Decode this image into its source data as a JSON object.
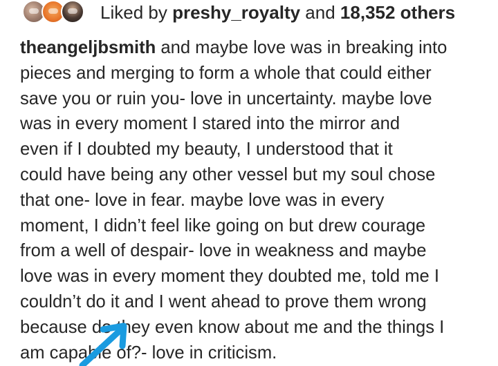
{
  "likes": {
    "prefix": "Liked by",
    "user": "preshy_royalty",
    "conjunction": "and",
    "count": "18,352 others"
  },
  "caption": {
    "username": "theangeljbsmith",
    "lines": [
      " and maybe love was in breaking into",
      "pieces and merging to form a whole that could either",
      "save you or ruin you- love in uncertainty. maybe love",
      "was in every moment I stared into the mirror and",
      "even if I doubted my beauty, I understood that it",
      "could have being any other vessel but my soul chose",
      "that one- love in fear. maybe love was in every",
      "moment, I didn’t feel like going on but drew courage",
      "from a well of despair- love in weakness and maybe",
      "love was in every moment they doubted me, told me I",
      "couldn’t do it and I went ahead to prove them wrong",
      "because do they even know about me and the things I",
      "am capable of?- love in criticism."
    ]
  },
  "annotation": {
    "icon": "arrow-annotation-icon",
    "color": "#1a9be0"
  },
  "colors": {
    "text": "#262626",
    "background": "#ffffff"
  }
}
